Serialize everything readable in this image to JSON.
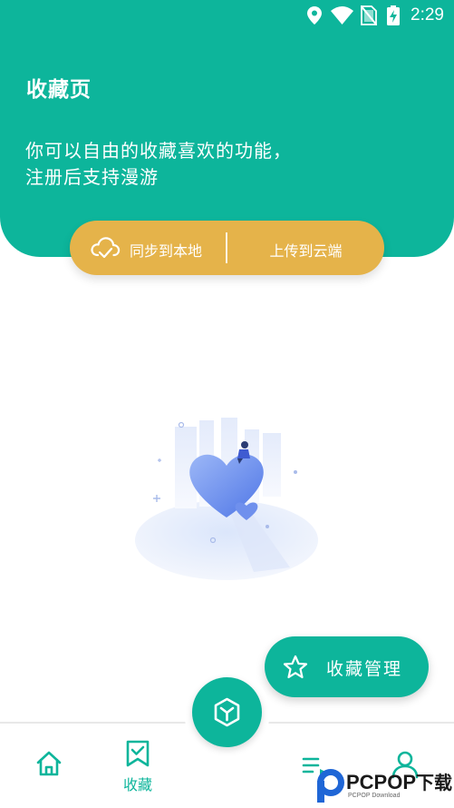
{
  "colors": {
    "primary": "#0db59b",
    "accent": "#e5b34a",
    "white": "#ffffff"
  },
  "status_bar": {
    "time": "2:29",
    "icons": [
      "location-icon",
      "wifi-icon",
      "no-sim-icon",
      "battery-charging-icon"
    ]
  },
  "header": {
    "title": "收藏页",
    "description": "你可以自由的收藏喜欢的功能，注册后支持漫游"
  },
  "sync_bar": {
    "sync_local_label": "同步到本地",
    "sync_local_icon": "cloud-sync-icon",
    "upload_cloud_label": "上传到云端"
  },
  "empty_state": {
    "illustration": "empty-favorites-illustration"
  },
  "manage_fab": {
    "label": "收藏管理",
    "icon": "star-icon"
  },
  "bottom_nav": {
    "center_icon": "cube-icon",
    "items": [
      {
        "icon": "home-icon",
        "label": ""
      },
      {
        "icon": "bookmark-check-icon",
        "label": "收藏",
        "active": true
      },
      {
        "icon": "list-icon",
        "label": ""
      },
      {
        "icon": "user-icon",
        "label": ""
      }
    ]
  },
  "watermark": {
    "brand": "PCPOP",
    "suffix": "下载",
    "sub": "PCPOP Download"
  }
}
